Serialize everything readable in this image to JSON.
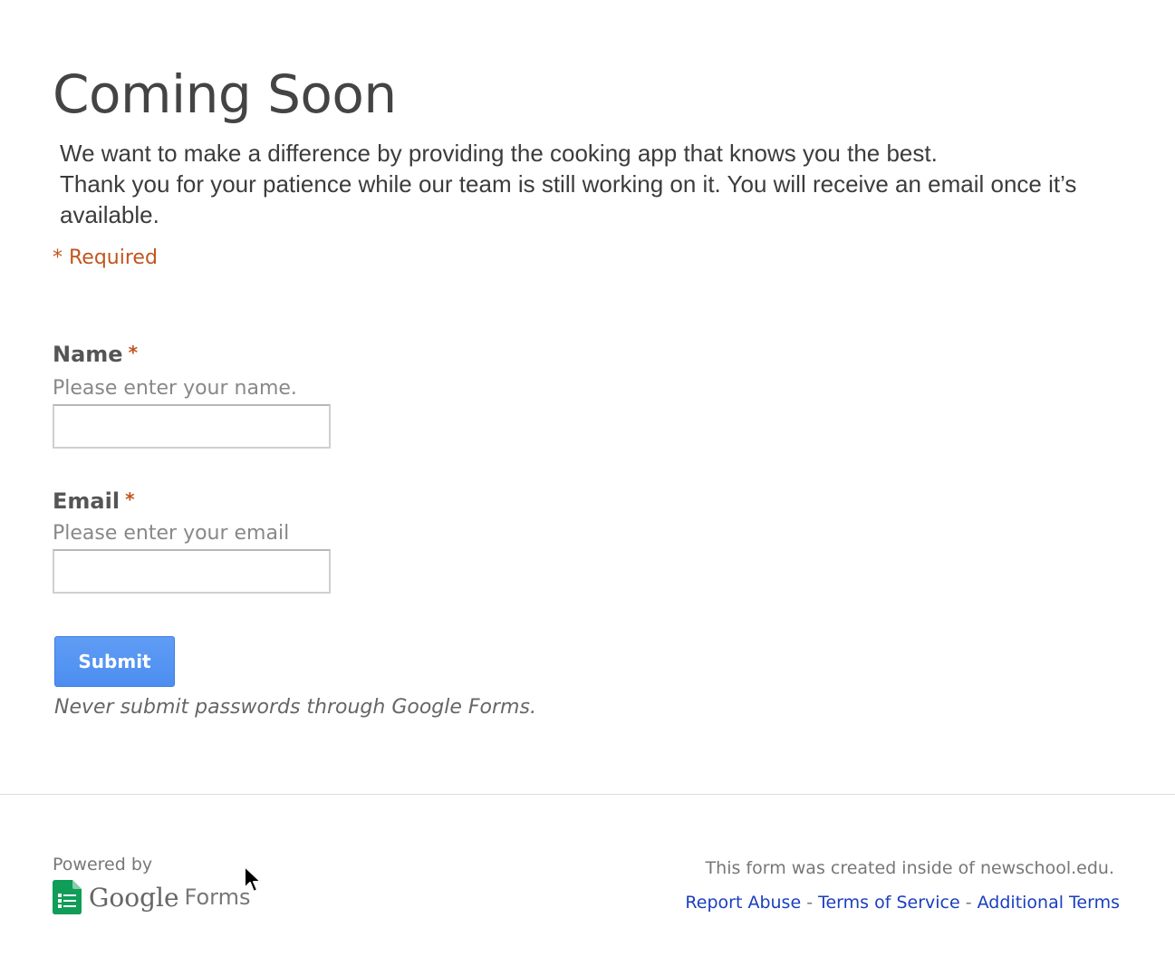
{
  "form": {
    "title": "Coming Soon",
    "description_lines": [
      "We want to make a difference by providing the cooking app that knows you the best.",
      "Thank you for your patience while our team is still working on it. You will receive an email once it’s available."
    ],
    "required_note": "* Required",
    "questions": [
      {
        "label": "Name",
        "required_mark": "*",
        "help_text": "Please enter your name.",
        "value": ""
      },
      {
        "label": "Email",
        "required_mark": "*",
        "help_text": "Please enter your email",
        "value": ""
      }
    ],
    "submit_label": "Submit",
    "password_warning": "Never submit passwords through Google Forms."
  },
  "footer": {
    "powered_by": "Powered by",
    "brand_google": "Google",
    "brand_forms": "Forms",
    "brand_icon": "google-forms-icon",
    "created_inside": "This form was created inside of newschool.edu.",
    "links": [
      "Report Abuse",
      "Terms of Service",
      "Additional Terms"
    ],
    "link_separator": "-"
  },
  "colors": {
    "required": "#c2551e",
    "submit_button": "#4c8ef0",
    "link": "#1a3fbf",
    "forms_icon": "#0f9d58"
  }
}
